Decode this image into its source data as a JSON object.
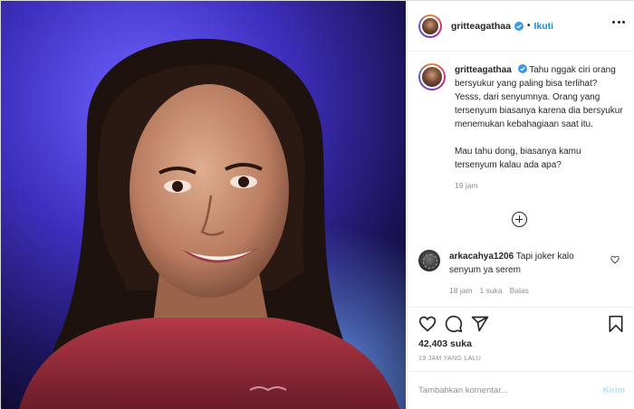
{
  "post": {
    "username": "gritteagathaa",
    "verified": true,
    "follow_label": "Ikuti",
    "separator": "•"
  },
  "caption": {
    "username": "gritteagathaa",
    "paragraph1": "Tahu nggak ciri orang bersyukur yang paling bisa terlihat? Yesss, dari senyumnya. Orang yang tersenyum biasanya karena dia bersyukur menemukan kebahagiaan saat itu.",
    "paragraph2": "Mau tahu dong, biasanya kamu tersenyum kalau ada apa?",
    "time": "19 jam"
  },
  "reply": {
    "username": "arkacahya1206",
    "text": "Tapi joker kalo senyum ya serem",
    "time": "18 jam",
    "likes": "1 suka",
    "reply_label": "Balas"
  },
  "stats": {
    "likes": "42,403 suka",
    "posted": "19 JAM YANG LALU"
  },
  "comment_box": {
    "placeholder": "Tambahkan komentar...",
    "post_label": "Kirim"
  },
  "icons": {
    "like": "heart-icon",
    "comment": "comment-icon",
    "share": "share-icon",
    "save": "bookmark-icon",
    "more": "more-icon",
    "load_more": "plus-circle-icon"
  },
  "colors": {
    "accent": "#0095f6",
    "verified": "#3897f0",
    "muted": "#8e8e8e",
    "post_button_disabled": "#b2dffc"
  }
}
